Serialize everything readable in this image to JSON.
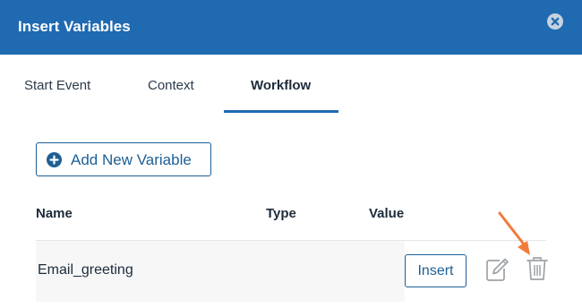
{
  "dialog": {
    "title": "Insert Variables"
  },
  "tabs": [
    {
      "label": "Start Event",
      "active": false
    },
    {
      "label": "Context",
      "active": false
    },
    {
      "label": "Workflow",
      "active": true
    }
  ],
  "actions": {
    "add_variable_label": "Add New Variable"
  },
  "table": {
    "columns": [
      "Name",
      "Type",
      "Value"
    ],
    "rows": [
      {
        "name": "Email_greeting",
        "type": "",
        "value": "",
        "insert_label": "Insert"
      }
    ]
  },
  "colors": {
    "header": "#1f6ab0",
    "accent": "#1d5f95",
    "annotation_arrow": "#f07b3a",
    "text": "#1d2b3a"
  },
  "icons": [
    "close-icon",
    "plus-circle-icon",
    "edit-icon",
    "trash-icon",
    "arrow-annotation"
  ]
}
